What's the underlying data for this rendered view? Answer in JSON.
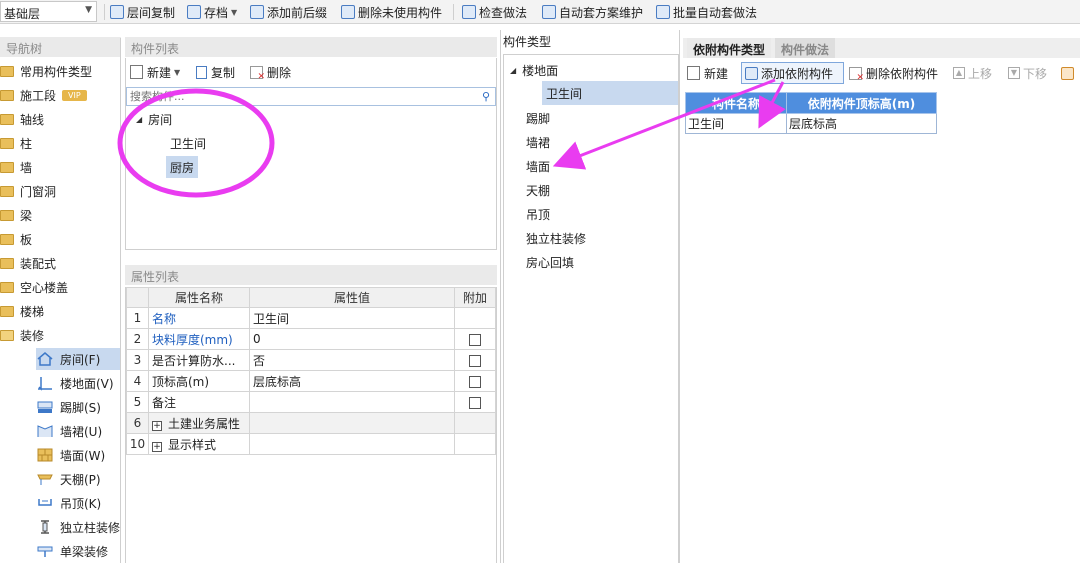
{
  "toolbar": {
    "layer_value": "基础层",
    "buttons": {
      "layer_copy": "层间复制",
      "save": "存档",
      "add_prefix": "添加前后缀",
      "delete_unused": "删除未使用构件",
      "check_method": "检查做法",
      "auto_scheme": "自动套方案维护",
      "batch_auto": "批量自动套做法"
    }
  },
  "nav": {
    "header": "导航树",
    "items": [
      "常用构件类型",
      "施工段",
      "轴线",
      "柱",
      "墙",
      "门窗洞",
      "梁",
      "板",
      "装配式",
      "空心楼盖",
      "楼梯",
      "装修"
    ],
    "vip_badge": "VIP",
    "subitems": [
      "房间(F)",
      "楼地面(V)",
      "踢脚(S)",
      "墙裙(U)",
      "墙面(W)",
      "天棚(P)",
      "吊顶(K)",
      "独立柱装修",
      "单梁装修"
    ]
  },
  "component_list": {
    "header": "构件列表",
    "new_label": "新建",
    "copy_label": "复制",
    "delete_label": "删除",
    "search_placeholder": "搜索构件...",
    "tree": {
      "root": "房间",
      "children": [
        "卫生间",
        "厨房"
      ]
    }
  },
  "properties": {
    "header": "属性列表",
    "columns": [
      "属性名称",
      "属性值",
      "附加"
    ],
    "rows": [
      {
        "num": "1",
        "name": "名称",
        "value": "卫生间"
      },
      {
        "num": "2",
        "name": "块料厚度(mm)",
        "value": "0"
      },
      {
        "num": "3",
        "name": "是否计算防水...",
        "value": "否"
      },
      {
        "num": "4",
        "name": "顶标高(m)",
        "value": "层底标高"
      },
      {
        "num": "5",
        "name": "备注",
        "value": ""
      },
      {
        "num": "6",
        "name": "土建业务属性",
        "value": ""
      },
      {
        "num": "10",
        "name": "显示样式",
        "value": ""
      }
    ]
  },
  "component_type": {
    "header": "构件类型",
    "tree": {
      "root": "楼地面",
      "root_child": "卫生间",
      "items": [
        "踢脚",
        "墙裙",
        "墙面",
        "天棚",
        "吊顶",
        "独立柱装修",
        "房心回填"
      ]
    }
  },
  "dependent": {
    "tabs": [
      "依附构件类型",
      "构件做法"
    ],
    "buttons": {
      "new": "新建",
      "add": "添加依附构件",
      "delete": "删除依附构件",
      "up": "上移",
      "down": "下移"
    },
    "columns": [
      "构件名称",
      "依附构件顶标高(m)"
    ],
    "rows": [
      {
        "name": "卫生间",
        "top": "层底标高"
      }
    ]
  },
  "annotation_color": "#e93cf0"
}
